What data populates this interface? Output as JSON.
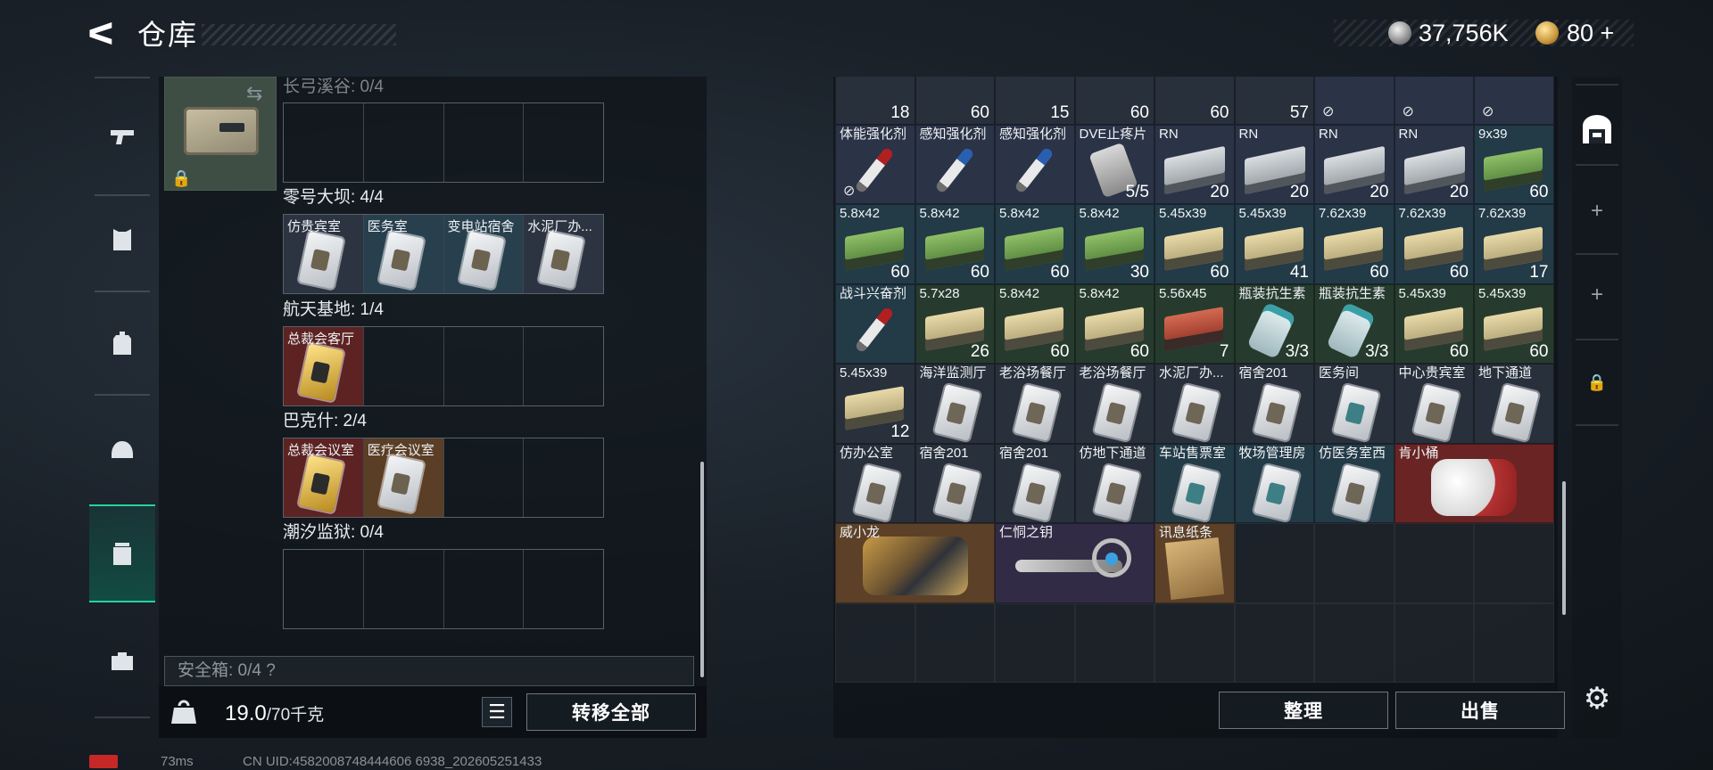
{
  "header": {
    "title": "仓库",
    "back_glyph": "ᐸ",
    "currency": [
      {
        "icon": "silver-coin-icon",
        "value": "37,756K"
      },
      {
        "icon": "gold-coin-icon",
        "value": "80 +"
      }
    ]
  },
  "left_nav": {
    "items": [
      {
        "name": "weapon",
        "icon": "gun-icon"
      },
      {
        "name": "armor",
        "icon": "vest-icon"
      },
      {
        "name": "backpack",
        "icon": "backpack-icon"
      },
      {
        "name": "helmet",
        "icon": "helmet-icon"
      },
      {
        "name": "storage",
        "icon": "container-icon",
        "active": true
      },
      {
        "name": "toolbox",
        "icon": "toolbox-icon"
      }
    ]
  },
  "key_case": {
    "groups": [
      {
        "label": "长弓溪谷: 0/4",
        "cells": []
      },
      {
        "label": "零号大坝: 4/4",
        "cells": [
          "仿贵宾室",
          "医务室",
          "变电站宿舍",
          "水泥厂办..."
        ]
      },
      {
        "label": "航天基地: 1/4",
        "cells": [
          "总裁会客厅"
        ]
      },
      {
        "label": "巴克什: 2/4",
        "cells": [
          "总裁会议室",
          "医疗会议室"
        ]
      },
      {
        "label": "潮汐监狱: 0/4",
        "cells": []
      }
    ],
    "safe_box": "安全箱: 0/4  ?",
    "weight": "19.0",
    "weight_max": "/70千克",
    "transfer_all": "转移全部",
    "list_glyph": "☰"
  },
  "stash": {
    "top_row": [
      {
        "qty": "18",
        "color": "dark"
      },
      {
        "qty": "60",
        "color": "dark"
      },
      {
        "qty": "15",
        "color": "dark"
      },
      {
        "qty": "60",
        "color": "dark"
      },
      {
        "qty": "60",
        "color": "dark"
      },
      {
        "qty": "57",
        "color": "dark"
      },
      {
        "qty": "",
        "color": "navy",
        "no_image": true
      },
      {
        "qty": "",
        "color": "navy",
        "no_image": true
      },
      {
        "qty": "",
        "color": "navy",
        "no_image": true
      }
    ],
    "rows": [
      [
        {
          "name": "体能强化剂",
          "qty": "",
          "color": "navy",
          "img": "syringe",
          "no_image_badge": true
        },
        {
          "name": "感知强化剂",
          "qty": "",
          "color": "navy",
          "img": "syringe-blue"
        },
        {
          "name": "感知强化剂",
          "qty": "",
          "color": "navy",
          "img": "syringe-blue"
        },
        {
          "name": "DVE止疼片",
          "qty": "5/5",
          "color": "navy",
          "img": "pills"
        },
        {
          "name": "RN",
          "qty": "20",
          "color": "navy",
          "img": "box"
        },
        {
          "name": "RN",
          "qty": "20",
          "color": "navy",
          "img": "box"
        },
        {
          "name": "RN",
          "qty": "20",
          "color": "navy",
          "img": "box"
        },
        {
          "name": "RN",
          "qty": "20",
          "color": "navy",
          "img": "box"
        },
        {
          "name": "9x39",
          "qty": "60",
          "color": "blue",
          "img": "ammo-g"
        }
      ],
      [
        {
          "name": "5.8x42",
          "qty": "60",
          "color": "blue",
          "img": "ammo-g"
        },
        {
          "name": "5.8x42",
          "qty": "60",
          "color": "blue",
          "img": "ammo-g"
        },
        {
          "name": "5.8x42",
          "qty": "60",
          "color": "blue",
          "img": "ammo-g"
        },
        {
          "name": "5.8x42",
          "qty": "30",
          "color": "blue",
          "img": "ammo-g"
        },
        {
          "name": "5.45x39",
          "qty": "60",
          "color": "blue",
          "img": "ammo-y"
        },
        {
          "name": "5.45x39",
          "qty": "41",
          "color": "blue",
          "img": "ammo-y"
        },
        {
          "name": "7.62x39",
          "qty": "60",
          "color": "blue",
          "img": "ammo-y"
        },
        {
          "name": "7.62x39",
          "qty": "60",
          "color": "blue",
          "img": "ammo-y"
        },
        {
          "name": "7.62x39",
          "qty": "17",
          "color": "blue",
          "img": "ammo-y"
        }
      ],
      [
        {
          "name": "战斗兴奋剂",
          "qty": "",
          "color": "blue",
          "img": "syringe"
        },
        {
          "name": "5.7x28",
          "qty": "26",
          "color": "green",
          "img": "ammo-y"
        },
        {
          "name": "5.8x42",
          "qty": "60",
          "color": "green",
          "img": "ammo-y"
        },
        {
          "name": "5.8x42",
          "qty": "60",
          "color": "green",
          "img": "ammo-y"
        },
        {
          "name": "5.56x45",
          "qty": "7",
          "color": "green",
          "img": "ammo-r"
        },
        {
          "name": "瓶装抗生素",
          "qty": "3/3",
          "color": "green",
          "img": "bottle"
        },
        {
          "name": "瓶装抗生素",
          "qty": "3/3",
          "color": "green",
          "img": "bottle"
        },
        {
          "name": "5.45x39",
          "qty": "60",
          "color": "green",
          "img": "ammo-y"
        },
        {
          "name": "5.45x39",
          "qty": "60",
          "color": "green",
          "img": "ammo-y"
        }
      ],
      [
        {
          "name": "5.45x39",
          "qty": "12",
          "color": "dark",
          "img": "ammo-y"
        },
        {
          "name": "海洋监测厅",
          "qty": "",
          "color": "dark",
          "img": "card"
        },
        {
          "name": "老浴场餐厅",
          "qty": "",
          "color": "dark",
          "img": "card"
        },
        {
          "name": "老浴场餐厅",
          "qty": "",
          "color": "dark",
          "img": "card"
        },
        {
          "name": "水泥厂办...",
          "qty": "",
          "color": "dark",
          "img": "card"
        },
        {
          "name": "宿舍201",
          "qty": "",
          "color": "dark",
          "img": "card"
        },
        {
          "name": "医务间",
          "qty": "",
          "color": "dark",
          "img": "card-teal"
        },
        {
          "name": "中心贵宾室",
          "qty": "",
          "color": "dark",
          "img": "card"
        },
        {
          "name": "地下通道",
          "qty": "",
          "color": "dark",
          "img": "card"
        }
      ],
      [
        {
          "name": "仿办公室",
          "qty": "",
          "color": "dark",
          "img": "card"
        },
        {
          "name": "宿舍201",
          "qty": "",
          "color": "dark",
          "img": "card"
        },
        {
          "name": "宿舍201",
          "qty": "",
          "color": "dark",
          "img": "card"
        },
        {
          "name": "仿地下通道",
          "qty": "",
          "color": "dark",
          "img": "card"
        },
        {
          "name": "车站售票室",
          "qty": "",
          "color": "blue",
          "img": "card-teal"
        },
        {
          "name": "牧场管理房",
          "qty": "",
          "color": "blue",
          "img": "card-teal"
        },
        {
          "name": "仿医务室西",
          "qty": "",
          "color": "blue",
          "img": "card"
        },
        {
          "name": "肯小桶",
          "qty": "",
          "color": "red",
          "img": "big-ko",
          "span": 2
        }
      ],
      [
        {
          "name": "威小龙",
          "qty": "",
          "color": "brown",
          "img": "big-wxl",
          "span": 2
        },
        {
          "name": "仁恫之钥",
          "qty": "",
          "color": "purple",
          "img": "big-key",
          "span": 2
        },
        {
          "name": "讯息纸条",
          "qty": "",
          "color": "brown",
          "img": "paper"
        },
        {
          "empty": true
        },
        {
          "empty": true
        },
        {
          "empty": true
        },
        {
          "empty": true
        }
      ]
    ],
    "sort": "整理",
    "sell": "出售"
  },
  "right_bar": {
    "items": [
      {
        "icon": "stash-icon"
      },
      {
        "icon": "plus-icon",
        "glyph": "+"
      },
      {
        "icon": "plus-icon",
        "glyph": "+"
      },
      {
        "icon": "lock-icon",
        "glyph": "🔒"
      }
    ]
  },
  "footer": {
    "ping": "73ms",
    "uid": "CN UID:4582008748444606 6938_202605251433"
  },
  "colors": {
    "accent": "#21d49b",
    "rarity_red": "#6a2424",
    "rarity_green": "#263b2e",
    "rarity_blue": "#233a47",
    "rarity_purple": "#322b45"
  }
}
